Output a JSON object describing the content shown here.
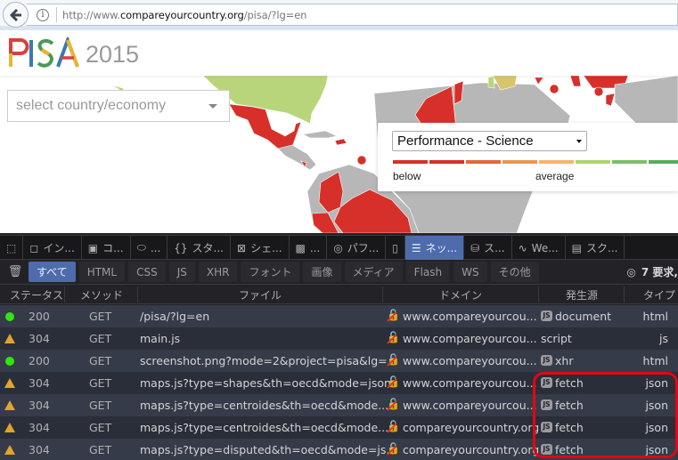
{
  "browser": {
    "url_prefix": "http://www.",
    "url_domain": "compareyourcountry.org",
    "url_path": "/pisa/?lg=en"
  },
  "page": {
    "logo_letters": [
      {
        "char": "P",
        "color": "#d8403a"
      },
      {
        "char": "I",
        "color": "#3a79b5"
      },
      {
        "char": "S",
        "color": "#e8b62f"
      },
      {
        "char": "A",
        "color": "#4a9a57"
      }
    ],
    "logo_year": "2015",
    "country_select_placeholder": "select country/economy",
    "indicator_selected": "Performance - Science",
    "legend_low_label": "below",
    "legend_mid_label": "average",
    "scale_colors": [
      "#d73027",
      "#d73027",
      "#e4663a",
      "#ec9552",
      "#f2b56c",
      "#aed473",
      "#7cbf66",
      "#5aac5c"
    ],
    "map_colors": {
      "below": "#d7302a",
      "above": "#b9d57a",
      "near": "#d8c46a",
      "no_data": "#b7b7b7"
    }
  },
  "devtools": {
    "tabs": [
      {
        "icon": "pick-element-icon",
        "glyph": "⬚",
        "label": ""
      },
      {
        "icon": "inspector-icon",
        "glyph": "◻",
        "label": "イン..."
      },
      {
        "icon": "console-icon",
        "glyph": "▣",
        "label": "コ..."
      },
      {
        "icon": "debugger-icon",
        "glyph": "⬭",
        "label": "..."
      },
      {
        "icon": "style-editor-icon",
        "glyph": "{}",
        "label": "スタ..."
      },
      {
        "icon": "shader-editor-icon",
        "glyph": "⊠",
        "label": "シェ..."
      },
      {
        "icon": "canvas-icon",
        "glyph": "▩",
        "label": "..."
      },
      {
        "icon": "performance-icon",
        "glyph": "◎",
        "label": "パフ..."
      },
      {
        "icon": "responsive-icon",
        "glyph": "▯",
        "label": ""
      },
      {
        "icon": "network-icon",
        "glyph": "☰",
        "label": "ネッ...",
        "active": true
      },
      {
        "icon": "storage-icon",
        "glyph": "⛁",
        "label": "ス..."
      },
      {
        "icon": "webaudio-icon",
        "glyph": "∿",
        "label": "We..."
      },
      {
        "icon": "scratchpad-icon",
        "glyph": "▤",
        "label": "スク..."
      }
    ],
    "filters": [
      {
        "label": "すべて",
        "active": true
      },
      {
        "label": "HTML"
      },
      {
        "label": "CSS"
      },
      {
        "label": "JS"
      },
      {
        "label": "XHR"
      },
      {
        "label": "フォント"
      },
      {
        "label": "画像"
      },
      {
        "label": "メディア"
      },
      {
        "label": "Flash"
      },
      {
        "label": "WS"
      },
      {
        "label": "その他"
      }
    ],
    "request_count": "7 要求,",
    "columns": {
      "status": "ステータス",
      "method": "メソッド",
      "file": "ファイル",
      "domain": "ドメイン",
      "cause": "発生源",
      "type": "タイプ"
    },
    "rows": [
      {
        "state": "ok",
        "status": "200",
        "method": "GET",
        "file": "/pisa/?lg=en",
        "domain": "www.compareyourcou...",
        "cause": "document",
        "cause_js": true,
        "type": "html"
      },
      {
        "state": "cached",
        "status": "304",
        "method": "GET",
        "file": "main.js",
        "domain": "www.compareyourcou...",
        "cause": "script",
        "cause_js": false,
        "type": "js"
      },
      {
        "state": "ok",
        "status": "200",
        "method": "GET",
        "file": "screenshot.png?mode=2&project=pisa&lg=...",
        "domain": "www.compareyourcou...",
        "cause": "xhr",
        "cause_js": true,
        "type": "html"
      },
      {
        "state": "cached",
        "status": "304",
        "method": "GET",
        "file": "maps.js?type=shapes&th=oecd&mode=json",
        "domain": "www.compareyourcou...",
        "cause": "fetch",
        "cause_js": true,
        "type": "json"
      },
      {
        "state": "cached",
        "status": "304",
        "method": "GET",
        "file": "maps.js?type=centroides&th=oecd&mode...",
        "domain": "www.compareyourcou...",
        "cause": "fetch",
        "cause_js": true,
        "type": "json"
      },
      {
        "state": "cached",
        "status": "304",
        "method": "GET",
        "file": "maps.js?type=centroides&th=oecd&mode...",
        "domain": "compareyourcountry.org",
        "cause": "fetch",
        "cause_js": true,
        "type": "json"
      },
      {
        "state": "cached",
        "status": "304",
        "method": "GET",
        "file": "maps.js?type=disputed&th=oecd&mode=js...",
        "domain": "compareyourcountry.org",
        "cause": "fetch",
        "cause_js": true,
        "type": "json"
      }
    ],
    "js_badge": "JS",
    "highlight_color": "#e30613"
  }
}
